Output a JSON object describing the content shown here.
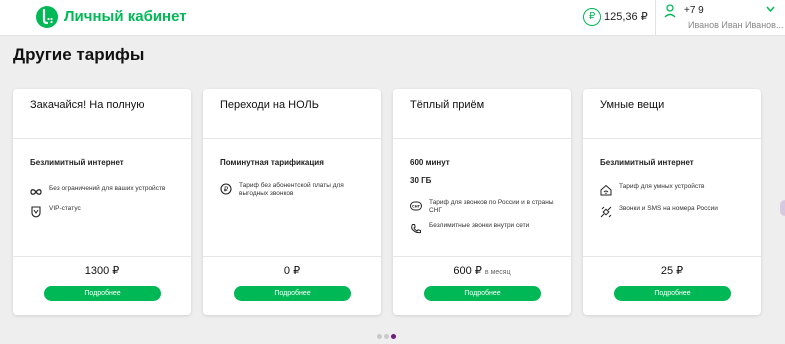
{
  "header": {
    "brand": "Личный кабинет",
    "balance": "125,36 ₽",
    "balance_icon": "ruble-circle-icon",
    "phone": "+7 9",
    "username": "Иванов Иван Иванов..."
  },
  "page_title": "Другие тарифы",
  "colors": {
    "accent": "#00b956",
    "active_dot": "#731982"
  },
  "cards": [
    {
      "title": "Закачайся! На полную",
      "headline": "Безлимитный интернет",
      "features": [
        {
          "icon": "infinity-icon",
          "text": "Без ограничений для ваших устройств"
        },
        {
          "icon": "vip-badge-icon",
          "text": "VIP-статус"
        }
      ],
      "price": "1300 ₽",
      "button": "Подробнее"
    },
    {
      "title": "Переходи на НОЛЬ",
      "headline": "Поминутная тарификация",
      "features": [
        {
          "icon": "ruble-coin-icon",
          "text": "Тариф без абонентской платы для выгодных звонков"
        }
      ],
      "price": "0 ₽",
      "button": "Подробнее"
    },
    {
      "title": "Тёплый приём",
      "headline": "600 минут",
      "headline2": "30 ГБ",
      "features": [
        {
          "icon": "sng-icon",
          "text": "Тариф для звонков по России и в страны СНГ"
        },
        {
          "icon": "phone-icon",
          "text": "Безлимитные звонки внутри сети"
        }
      ],
      "price": "600 ₽",
      "price_suffix": "в месяц",
      "button": "Подробнее"
    },
    {
      "title": "Умные вещи",
      "headline": "Безлимитный интернет",
      "features": [
        {
          "icon": "smart-home-icon",
          "text": "Тариф для умных устройств"
        },
        {
          "icon": "satellite-icon",
          "text": "Звонки и SMS на номера России"
        }
      ],
      "price": "25 ₽",
      "button": "Подробнее"
    }
  ],
  "pagination": {
    "total": 3,
    "active": 3
  }
}
